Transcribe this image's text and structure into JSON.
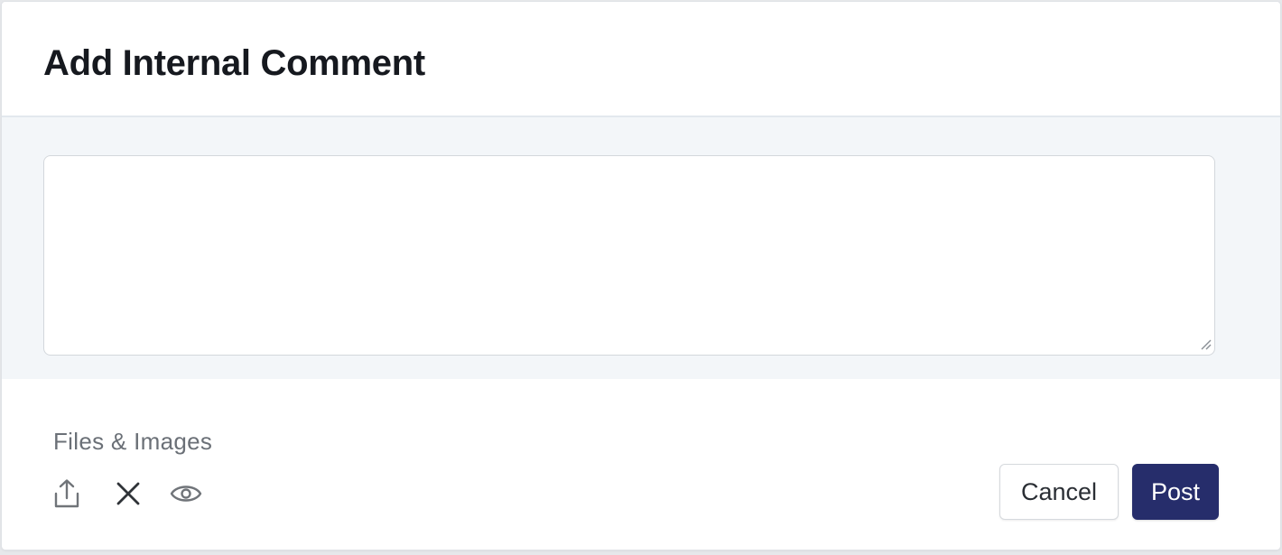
{
  "dialog": {
    "title": "Add Internal Comment"
  },
  "comment": {
    "value": "",
    "placeholder": ""
  },
  "attachments": {
    "label": "Files & Images",
    "icons": [
      "upload-icon",
      "close-icon",
      "eye-icon"
    ]
  },
  "actions": {
    "cancel_label": "Cancel",
    "post_label": "Post"
  },
  "colors": {
    "primary": "#262d6b",
    "title_text": "#16191f",
    "muted_text": "#6b7077",
    "body_background": "#f3f6f9"
  }
}
